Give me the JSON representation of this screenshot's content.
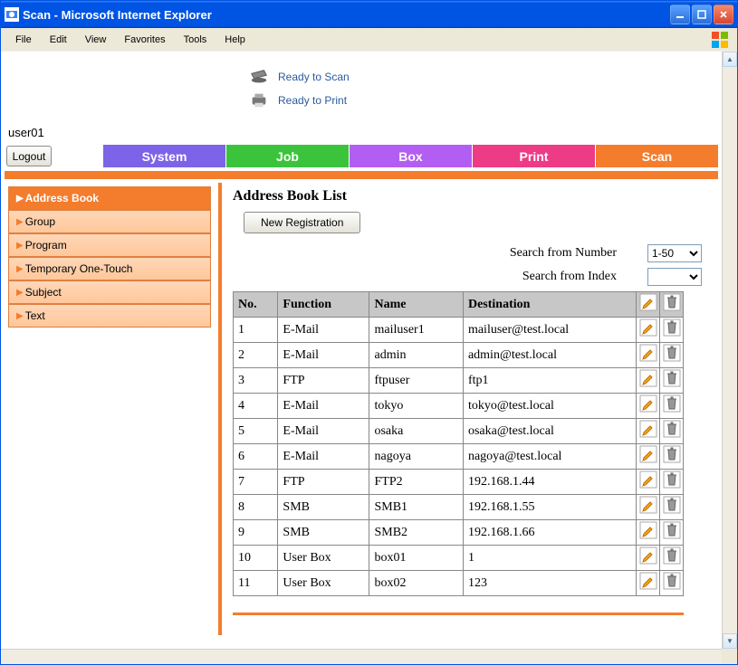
{
  "window": {
    "title": "Scan - Microsoft Internet Explorer"
  },
  "menu": {
    "items": [
      "File",
      "Edit",
      "View",
      "Favorites",
      "Tools",
      "Help"
    ]
  },
  "statuses": {
    "scan": "Ready to Scan",
    "print": "Ready to Print"
  },
  "user": "user01",
  "buttons": {
    "logout": "Logout",
    "new_reg": "New Registration"
  },
  "nav": {
    "system": "System",
    "job": "Job",
    "box": "Box",
    "print": "Print",
    "scan": "Scan"
  },
  "sidebar": {
    "items": [
      {
        "label": "Address Book",
        "active": true
      },
      {
        "label": "Group"
      },
      {
        "label": "Program"
      },
      {
        "label": "Temporary One-Touch"
      },
      {
        "label": "Subject"
      },
      {
        "label": "Text"
      }
    ]
  },
  "main": {
    "heading": "Address Book List",
    "search_number_label": "Search from Number",
    "search_index_label": "Search from Index",
    "search_number_value": "1-50",
    "search_index_value": "",
    "columns": {
      "no": "No.",
      "function": "Function",
      "name": "Name",
      "destination": "Destination"
    },
    "rows": [
      {
        "no": "1",
        "function": "E-Mail",
        "name": "mailuser1",
        "destination": "mailuser@test.local"
      },
      {
        "no": "2",
        "function": "E-Mail",
        "name": "admin",
        "destination": "admin@test.local"
      },
      {
        "no": "3",
        "function": "FTP",
        "name": "ftpuser",
        "destination": "ftp1"
      },
      {
        "no": "4",
        "function": "E-Mail",
        "name": "tokyo",
        "destination": "tokyo@test.local"
      },
      {
        "no": "5",
        "function": "E-Mail",
        "name": "osaka",
        "destination": "osaka@test.local"
      },
      {
        "no": "6",
        "function": "E-Mail",
        "name": "nagoya",
        "destination": "nagoya@test.local"
      },
      {
        "no": "7",
        "function": "FTP",
        "name": "FTP2",
        "destination": "192.168.1.44"
      },
      {
        "no": "8",
        "function": "SMB",
        "name": "SMB1",
        "destination": "192.168.1.55"
      },
      {
        "no": "9",
        "function": "SMB",
        "name": "SMB2",
        "destination": "192.168.1.66"
      },
      {
        "no": "10",
        "function": "User Box",
        "name": "box01",
        "destination": "1"
      },
      {
        "no": "11",
        "function": "User Box",
        "name": "box02",
        "destination": "123"
      }
    ]
  }
}
